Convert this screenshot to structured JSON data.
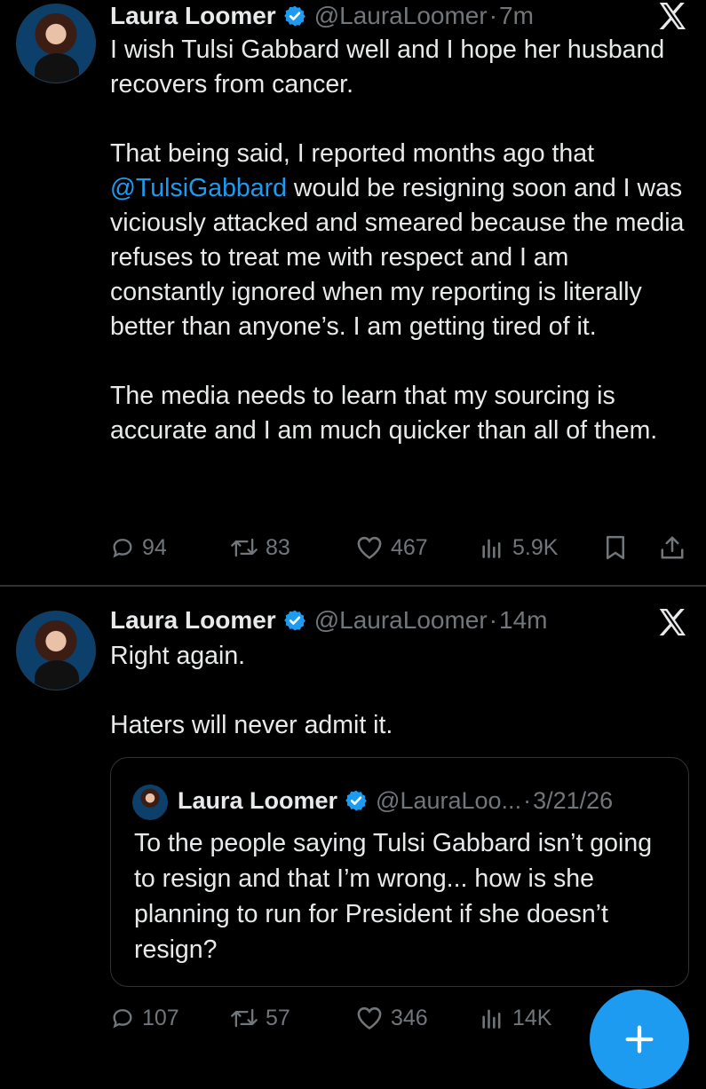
{
  "posts": [
    {
      "author_name": "Laura Loomer",
      "handle": "@LauraLoomer",
      "separator": "·",
      "time": "7m",
      "paragraphs": [
        {
          "before": "I wish Tulsi Gabbard well and I hope her husband recovers from cancer."
        },
        {
          "before": "That being said, I reported months ago that ",
          "mention": "@TulsiGabbard",
          "after": " would be resigning soon and I was viciously attacked and smeared because the media refuses to treat me with respect and I am constantly ignored when my reporting is literally better than anyone’s. I am getting tired of it."
        },
        {
          "before": "The media needs to learn that my sourcing is accurate and I am much quicker than all of them."
        }
      ],
      "stats": {
        "replies": "94",
        "reposts": "83",
        "likes": "467",
        "views": "5.9K"
      }
    },
    {
      "author_name": "Laura Loomer",
      "handle": "@LauraLoomer",
      "separator": "·",
      "time": "14m",
      "paragraphs": [
        {
          "before": "Right again."
        },
        {
          "before": "Haters will never admit it."
        }
      ],
      "quote": {
        "author_name": "Laura Loomer",
        "handle": "@LauraLoo...",
        "separator": "·",
        "date": "3/21/26",
        "text": "To the people saying Tulsi Gabbard isn’t going to resign and that I’m wrong... how is she planning to run for President if she doesn’t resign?"
      },
      "stats": {
        "replies": "107",
        "reposts": "57",
        "likes": "346",
        "views": "14K"
      }
    }
  ],
  "colors": {
    "background": "#000000",
    "text": "#e7e9ea",
    "muted": "#71767b",
    "accent": "#1d9bf0",
    "divider": "#2f3336"
  },
  "icons": [
    "reply-icon",
    "repost-icon",
    "like-icon",
    "views-icon",
    "bookmark-icon",
    "share-icon",
    "verified-badge-icon",
    "x-logo-icon",
    "compose-plus-icon"
  ]
}
